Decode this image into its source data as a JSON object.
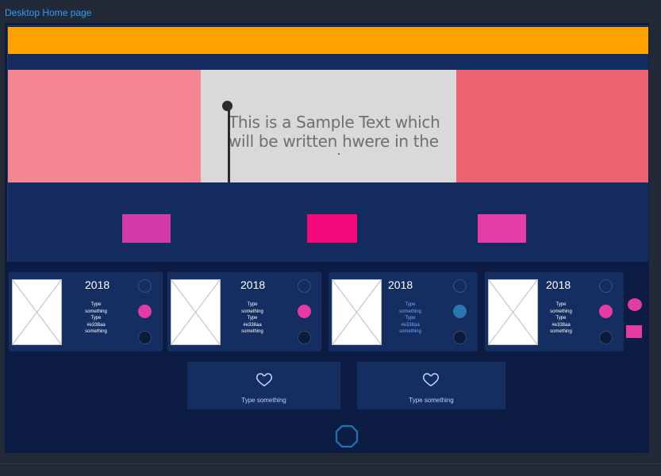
{
  "page": {
    "title": "Desktop Home page"
  },
  "hero": {
    "text": "This is a Sample Text which will be written hwere in the"
  },
  "band_buttons": [
    {
      "color": "#d23aa8"
    },
    {
      "color": "#f20a7a"
    },
    {
      "color": "#e53ca8"
    }
  ],
  "cards": [
    {
      "year": "2018",
      "meta": [
        "Type",
        "something",
        "Type",
        "#e338aa",
        "something"
      ],
      "middle_radio": "pink",
      "text_color": "#ffffff"
    },
    {
      "year": "2018",
      "meta": [
        "Type",
        "something",
        "Type",
        "#e338aa",
        "something"
      ],
      "middle_radio": "pink",
      "text_color": "#ffffff"
    },
    {
      "year": "2018",
      "meta": [
        "Type",
        "something",
        "Type",
        "#e338aa",
        "something"
      ],
      "middle_radio": "blue",
      "text_color": "#6ea8ff"
    },
    {
      "year": "2018",
      "meta": [
        "Type",
        "something",
        "Type",
        "#e338aa",
        "something"
      ],
      "middle_radio": "pink",
      "text_color": "#ffffff"
    }
  ],
  "favorites": [
    {
      "label": "Type something",
      "icon": "heart-icon"
    },
    {
      "label": "Type something",
      "icon": "heart-icon"
    }
  ],
  "colors": {
    "accent_orange": "#ffa200",
    "navy": "#132b5f",
    "pink": "#e63ba3",
    "link_blue": "#2f9bff"
  }
}
